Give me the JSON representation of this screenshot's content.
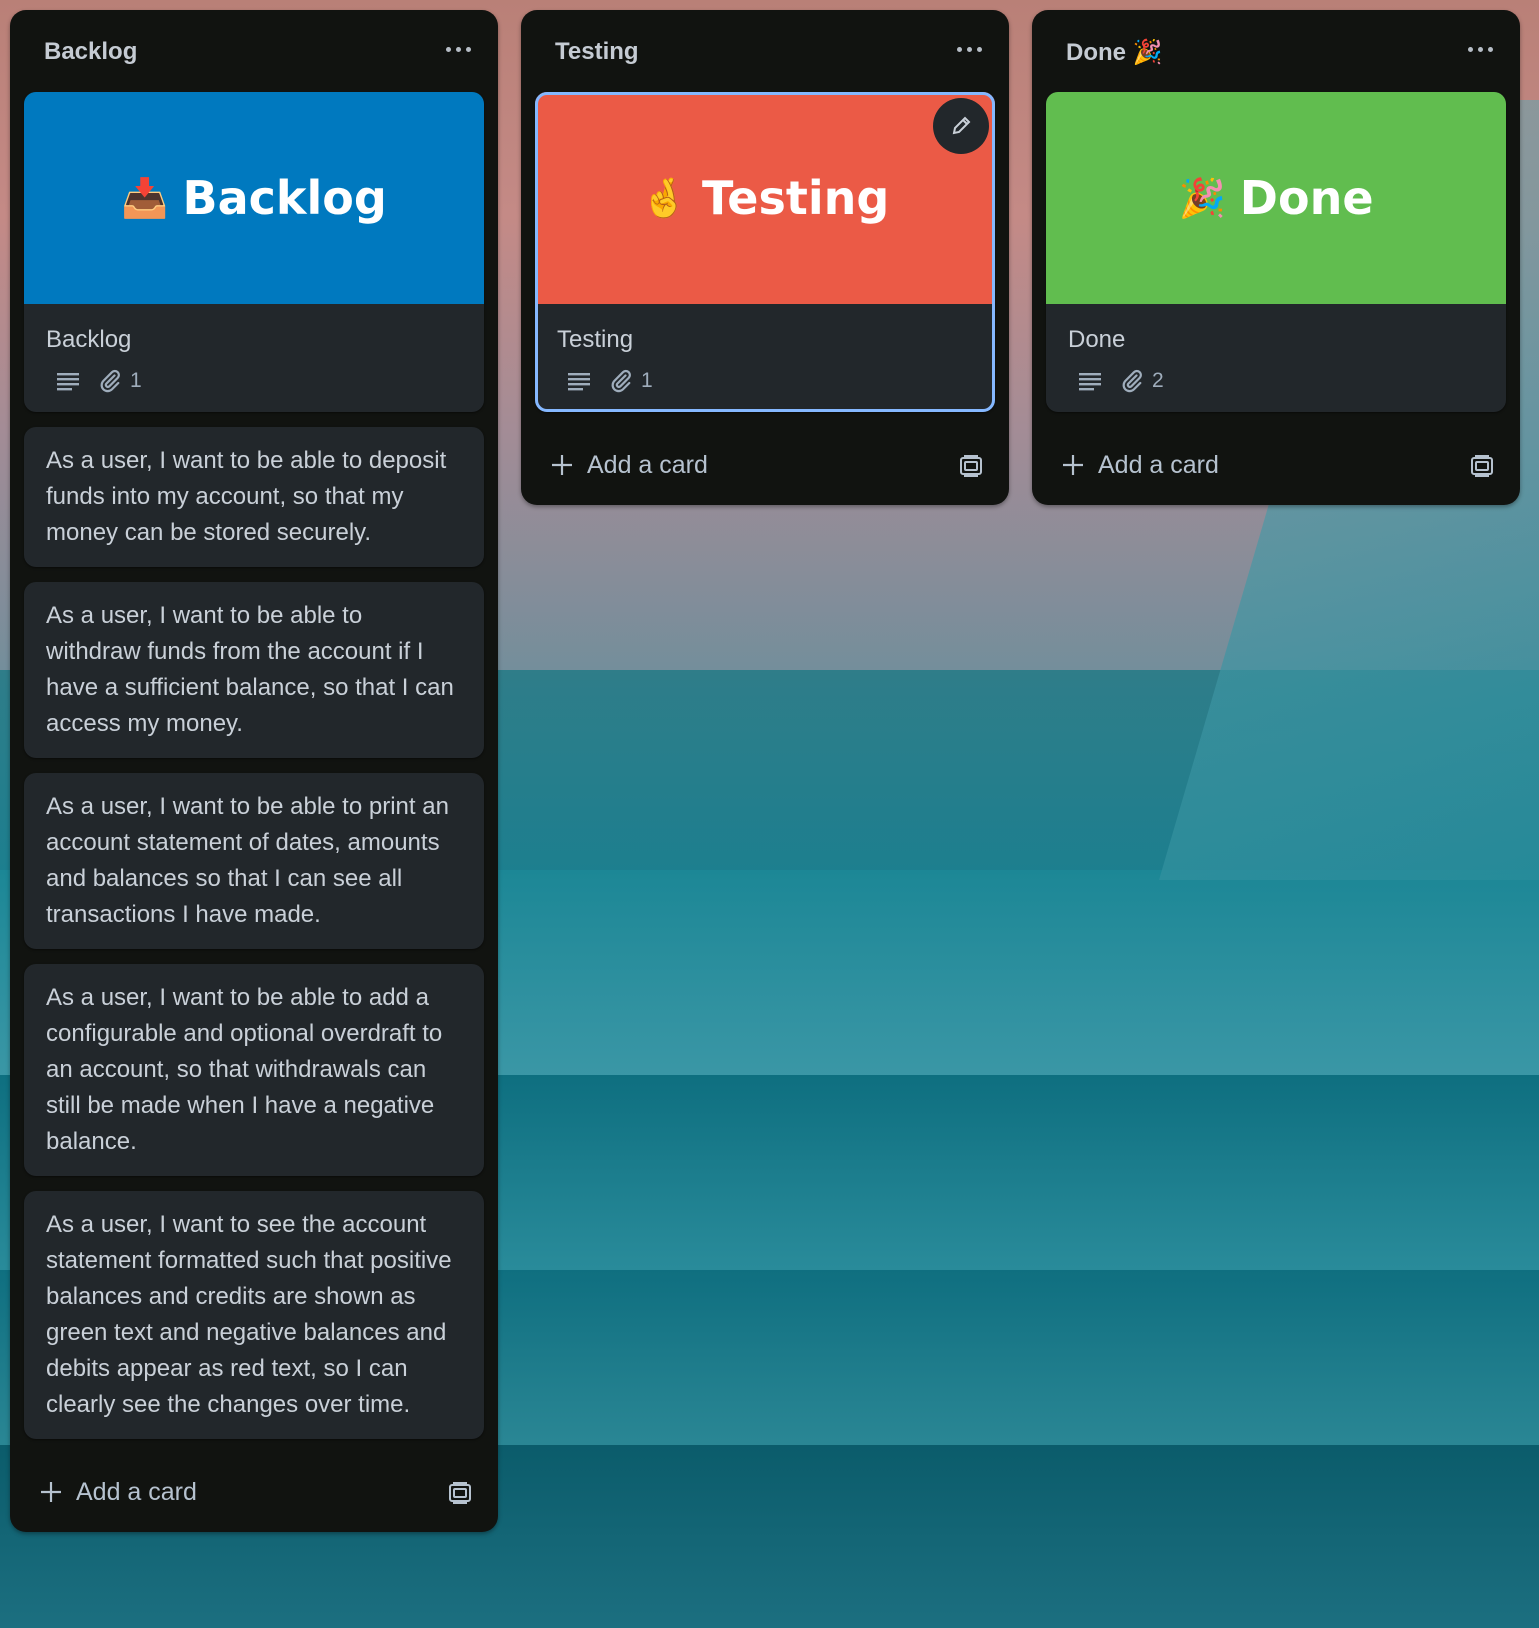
{
  "lists": [
    {
      "title": "Backlog",
      "cover_card": {
        "cover_text": "Backlog",
        "cover_emoji": "📥",
        "cover_color": "#0079bf",
        "title": "Backlog",
        "attachments": "1"
      },
      "stories": [
        "As a user, I want to be able to deposit funds into my account, so that my money can be stored securely.",
        "As a user, I want to be able to withdraw funds from the account if I have a sufficient balance, so that I can access my money.",
        "As a user, I want to be able to print an account statement of dates, amounts and balances so that I can see all transactions I have made.",
        "As a user, I want to be able to add a configurable and optional overdraft to an account, so that withdrawals can still be made when I have a negative balance.",
        "As a user, I want to see the account statement formatted such that positive balances and credits are shown as green text and negative balances and debits appear as red text, so I can clearly see the changes over time."
      ],
      "add_label": "Add a card"
    },
    {
      "title": "Testing",
      "cover_card": {
        "cover_text": "Testing",
        "cover_emoji": "🤞",
        "cover_color": "#eb5a46",
        "title": "Testing",
        "attachments": "1"
      },
      "add_label": "Add a card"
    },
    {
      "title": "Done 🎉",
      "cover_card": {
        "cover_text": "Done",
        "cover_emoji": "🎉",
        "cover_color": "#61bd4f",
        "title": "Done",
        "attachments": "2"
      },
      "add_label": "Add a card"
    }
  ],
  "colors": {
    "list_bg": "#111310",
    "card_bg": "#22272b",
    "selected_outline": "#85b8ff",
    "text": "#c9d0d8"
  },
  "icons": {
    "menu": "more-horizontal-icon",
    "description": "description-lines-icon",
    "attachment": "paperclip-icon",
    "add": "plus-icon",
    "template": "card-template-icon",
    "edit": "pencil-icon"
  }
}
